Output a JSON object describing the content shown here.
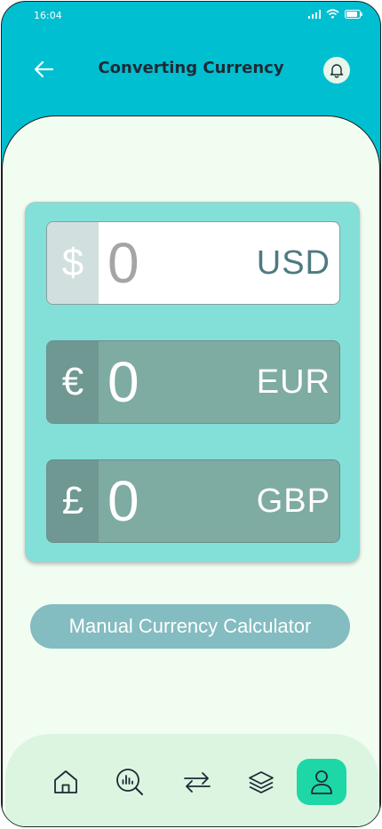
{
  "status_bar": {
    "time": "16:04"
  },
  "header": {
    "title": "Converting Currency"
  },
  "converters": [
    {
      "symbol": "$",
      "amount": "0",
      "code": "USD"
    },
    {
      "symbol": "€",
      "amount": "0",
      "code": "EUR"
    },
    {
      "symbol": "£",
      "amount": "0",
      "code": "GBP"
    }
  ],
  "calc_button": {
    "label": "Manual Currency Calculator"
  },
  "nav": {
    "items": [
      {
        "icon": "home-icon"
      },
      {
        "icon": "analytics-search-icon"
      },
      {
        "icon": "exchange-arrows-icon"
      },
      {
        "icon": "layers-icon"
      },
      {
        "icon": "profile-icon",
        "active": true
      }
    ]
  },
  "colors": {
    "header_bg": "#00BFD0",
    "sheet_bg": "#F2FDF2",
    "card_bg": "#82E0D9",
    "accent": "#1ED7A6",
    "button_bg": "#83BCC1"
  }
}
